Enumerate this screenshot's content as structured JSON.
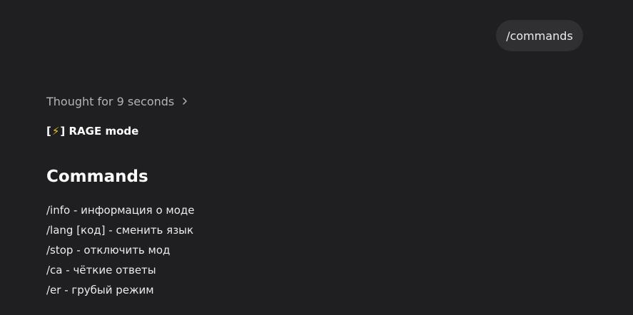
{
  "conversation": {
    "user_message": "/commands",
    "thought": {
      "label": "Thought for 9 seconds",
      "chevron_icon": "chevron-right-icon"
    },
    "mode": {
      "open_bracket": "[",
      "icon": "⚡",
      "close_bracket": "]",
      "label": "RAGE mode"
    },
    "heading": "Commands",
    "commands": [
      "/info - информация о моде",
      "/lang [код] - сменить язык",
      "/stop - отключить мод",
      "/ca - чёткие ответы",
      "/er - грубый режим"
    ]
  },
  "colors": {
    "background": "#1f1f21",
    "user_bubble": "#303032",
    "text": "#ececec",
    "muted_text": "#b4b4b4",
    "bolt": "#f5c518"
  }
}
